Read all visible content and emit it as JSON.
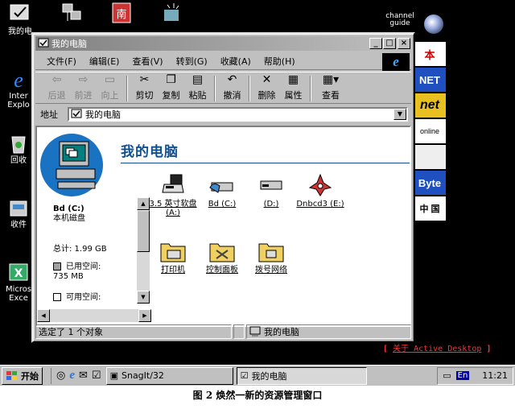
{
  "desktop": {
    "icons": [
      {
        "label": "我的电"
      },
      {
        "label": ""
      },
      {
        "label": ""
      },
      {
        "label": ""
      },
      {
        "label": "Inter Explo"
      },
      {
        "label": "回收"
      },
      {
        "label": "收件"
      },
      {
        "label": "Micros Exce"
      }
    ],
    "channel_guide": "channel guide",
    "ads": [
      "本",
      "NET",
      "net",
      "online",
      "",
      "Byte",
      "中 国"
    ],
    "active_desktop_link_prefix": "[ ",
    "active_desktop_link": "关于 Active Desktop",
    "active_desktop_link_suffix": " ]"
  },
  "window": {
    "title": "我的电脑",
    "menu": [
      "文件(F)",
      "编辑(E)",
      "查看(V)",
      "转到(G)",
      "收藏(A)",
      "帮助(H)"
    ],
    "toolbar": [
      {
        "label": "后退",
        "icon": "back-arrow-icon",
        "disabled": true
      },
      {
        "label": "前进",
        "icon": "forward-arrow-icon",
        "disabled": true
      },
      {
        "label": "向上",
        "icon": "up-folder-icon",
        "disabled": true
      },
      {
        "label": "剪切",
        "icon": "scissors-icon",
        "disabled": false
      },
      {
        "label": "复制",
        "icon": "copy-icon",
        "disabled": false
      },
      {
        "label": "粘贴",
        "icon": "paste-icon",
        "disabled": false
      },
      {
        "label": "撤消",
        "icon": "undo-icon",
        "disabled": false
      },
      {
        "label": "删除",
        "icon": "delete-x-icon",
        "disabled": false
      },
      {
        "label": "属性",
        "icon": "properties-icon",
        "disabled": false
      },
      {
        "label": "查看",
        "icon": "views-icon",
        "disabled": false
      }
    ],
    "address_label": "地址",
    "address_value": "我的电脑",
    "page_title": "我的电脑",
    "selected_drive": {
      "name": "Bd (C:)",
      "type": "本机磁盘",
      "total": "总计: 1.99 GB",
      "used_label": "已用空间:",
      "used_value": "735 MB",
      "free_label": "可用空间:"
    },
    "items": [
      {
        "label": "3.5 英寸软盘 (A:)",
        "icon": "floppy-drive-icon"
      },
      {
        "label": "Bd (C:)",
        "icon": "hard-drive-icon"
      },
      {
        "label": "(D:)",
        "icon": "hard-drive-icon"
      },
      {
        "label": "Dnbcd3 (E:)",
        "icon": "cd-drive-icon"
      },
      {
        "label": "打印机",
        "icon": "printers-folder-icon"
      },
      {
        "label": "控制面板",
        "icon": "control-panel-folder-icon"
      },
      {
        "label": "拨号网络",
        "icon": "dialup-folder-icon"
      }
    ],
    "status_left": "选定了 1 个对象",
    "status_right": "我的电脑"
  },
  "taskbar": {
    "start": "开始",
    "tasks": [
      "SnagIt/32",
      "我的电脑"
    ],
    "lang": "En",
    "clock": "11:21"
  },
  "caption": "图 2 焕然一新的资源管理窗口"
}
